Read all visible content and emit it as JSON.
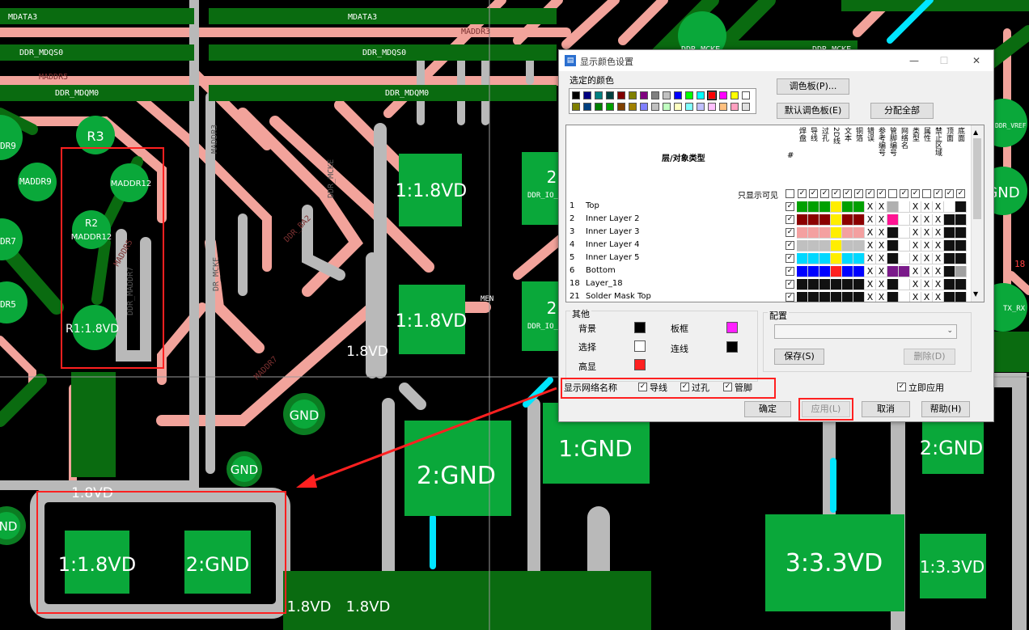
{
  "pcb": {
    "traces": [
      "MDATA3",
      "MDATA3",
      "DDR_MDQS0",
      "DDR_MDQS0",
      "MADDR5",
      "DDR_MDQM0",
      "DDR_MDQM0",
      "MADDR3",
      "MADDR3",
      "DDR_MCKE",
      "DDR_MCKE",
      "DDR_BA2",
      "DDR_VREF",
      "DR_MCKE",
      "DDR_MCKE",
      "MADDR7",
      "MADDR9",
      "DR9",
      "DR7",
      "DR5",
      "MADDR5",
      "DDR_MADDR7",
      "DDR_IO_",
      "DDR_IO_",
      "MEN",
      "TX_RX",
      "18"
    ],
    "parts": [
      {
        "ref": "R3"
      },
      {
        "ref": "R2",
        "net": "MADDR12"
      },
      {
        "ref": "MADDR12"
      },
      {
        "ref": "R1:1.8VD"
      },
      {
        "ref": "1:1.8VD"
      },
      {
        "ref": "1:1.8VD"
      },
      {
        "ref": "2"
      },
      {
        "ref": "2"
      },
      {
        "ref": "1.8VD"
      },
      {
        "ref": "GND"
      },
      {
        "ref": "GND"
      },
      {
        "ref": "ND"
      },
      {
        "ref": "GND"
      },
      {
        "ref": "2:GND"
      },
      {
        "ref": "1:GND"
      },
      {
        "ref": "2:GND"
      },
      {
        "ref": "3:3.3VD"
      },
      {
        "ref": "1:3.3VD"
      },
      {
        "ref": "1:1.8VD"
      },
      {
        "ref": "2:GND"
      },
      {
        "ref": "1.8VD"
      },
      {
        "ref": "1.8VD"
      },
      {
        "ref": "1.8VD"
      }
    ]
  },
  "dialog": {
    "title": "显示颜色设置",
    "selected_color_label": "选定的颜色",
    "palette_btn": "调色板(P)...",
    "default_palette_btn": "默认调色板(E)",
    "assign_all_btn": "分配全部",
    "grid": {
      "header": "层/对象类型",
      "hash": "#",
      "only_visible": "只显示可见",
      "columns": [
        "焊盘",
        "导线",
        "过孔",
        "2D线",
        "文本",
        "铜箔",
        "错误",
        "参考编号",
        "管脚编号",
        "网络名",
        "类型",
        "属性",
        "禁止区域",
        "顶面",
        "底面"
      ],
      "rows": [
        {
          "num": "1",
          "name": "Top",
          "colors": [
            "#00a000",
            "#00a000",
            "#00a000",
            "#ffee00",
            "#00a000",
            "#00a000",
            "X",
            "X",
            "#b0b0b0",
            "",
            "X",
            "X",
            "X",
            "#ffffff",
            "#111111"
          ]
        },
        {
          "num": "2",
          "name": "Inner Layer 2",
          "colors": [
            "#8b0000",
            "#8b0000",
            "#8b0000",
            "#ffee00",
            "#8b0000",
            "#8b0000",
            "X",
            "X",
            "#ff1493",
            "",
            "X",
            "X",
            "X",
            "#111111",
            "#111111"
          ]
        },
        {
          "num": "3",
          "name": "Inner Layer 3",
          "colors": [
            "#f4a0a0",
            "#f4a0a0",
            "#f4a0a0",
            "#ffee00",
            "#f4a0a0",
            "#f4a0a0",
            "X",
            "X",
            "#111111",
            "",
            "X",
            "X",
            "X",
            "#111111",
            "#111111"
          ]
        },
        {
          "num": "4",
          "name": "Inner Layer 4",
          "colors": [
            "#c0c0c0",
            "#c0c0c0",
            "#c0c0c0",
            "#ffee00",
            "#c0c0c0",
            "#c0c0c0",
            "X",
            "X",
            "#111111",
            "",
            "X",
            "X",
            "X",
            "#111111",
            "#111111"
          ]
        },
        {
          "num": "5",
          "name": "Inner Layer 5",
          "colors": [
            "#00d8ff",
            "#00d8ff",
            "#00d8ff",
            "#ffee00",
            "#00d8ff",
            "#00d8ff",
            "X",
            "X",
            "#111111",
            "",
            "X",
            "X",
            "X",
            "#111111",
            "#111111"
          ]
        },
        {
          "num": "6",
          "name": "Bottom",
          "colors": [
            "#0000ff",
            "#0000ff",
            "#0000ff",
            "#ff2020",
            "#0000ff",
            "#0000ff",
            "X",
            "X",
            "#7a1a8a",
            "#7a1a8a",
            "X",
            "X",
            "X",
            "#111111",
            "#a0a0a0"
          ]
        },
        {
          "num": "18",
          "name": "Layer_18",
          "colors": [
            "#111111",
            "#111111",
            "#111111",
            "#111111",
            "#111111",
            "#111111",
            "X",
            "X",
            "#111111",
            "",
            "X",
            "X",
            "X",
            "#111111",
            "#111111"
          ]
        },
        {
          "num": "21",
          "name": "Solder Mask Top",
          "colors": [
            "#111111",
            "#111111",
            "#111111",
            "#111111",
            "#111111",
            "#111111",
            "X",
            "X",
            "#111111",
            "",
            "X",
            "X",
            "X",
            "#111111",
            "#111111"
          ]
        }
      ]
    },
    "other_label": "其他",
    "background_label": "背景",
    "select_label": "选择",
    "highlight_label": "高显",
    "board_frame_label": "板框",
    "connection_label": "连线",
    "config_label": "配置",
    "save_btn": "保存(S)",
    "delete_btn": "删除(D)",
    "show_net_names_label": "显示网络名称",
    "trace_cb": "导线",
    "via_cb": "过孔",
    "pin_cb": "管脚",
    "apply_now_cb": "立即应用",
    "ok_btn": "确定",
    "apply_btn": "应用(L)",
    "cancel_btn": "取消",
    "help_btn": "帮助(H)",
    "colors": {
      "background": "#000000",
      "select": "#ffffff",
      "highlight": "#ff2020",
      "board_frame": "#ff20ff",
      "connection": "#000000"
    }
  }
}
